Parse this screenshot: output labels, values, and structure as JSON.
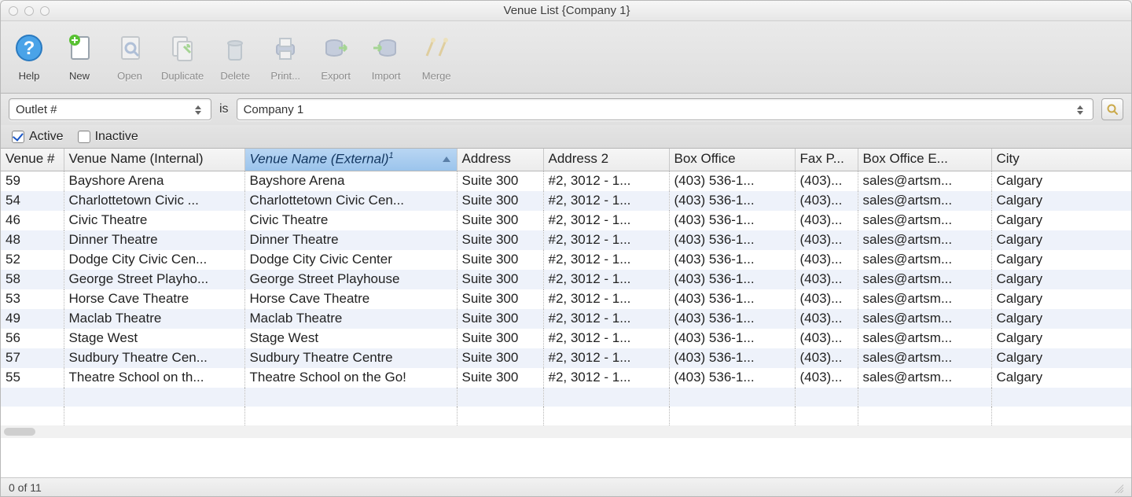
{
  "window": {
    "title": "Venue List {Company 1}"
  },
  "toolbar": [
    {
      "id": "help",
      "label": "Help",
      "enabled": true,
      "icon": "help-icon"
    },
    {
      "id": "new",
      "label": "New",
      "enabled": true,
      "icon": "new-icon"
    },
    {
      "id": "open",
      "label": "Open",
      "enabled": false,
      "icon": "open-icon"
    },
    {
      "id": "duplicate",
      "label": "Duplicate",
      "enabled": false,
      "icon": "duplicate-icon"
    },
    {
      "id": "delete",
      "label": "Delete",
      "enabled": false,
      "icon": "delete-icon"
    },
    {
      "id": "print",
      "label": "Print...",
      "enabled": false,
      "icon": "print-icon"
    },
    {
      "id": "export",
      "label": "Export",
      "enabled": false,
      "icon": "export-icon"
    },
    {
      "id": "import",
      "label": "Import",
      "enabled": false,
      "icon": "import-icon"
    },
    {
      "id": "merge",
      "label": "Merge",
      "enabled": false,
      "icon": "merge-icon"
    }
  ],
  "filter": {
    "field_select": "Outlet #",
    "operator": "is",
    "value_select": "Company 1",
    "active": {
      "label": "Active",
      "checked": true
    },
    "inactive": {
      "label": "Inactive",
      "checked": false
    }
  },
  "table": {
    "columns": [
      {
        "key": "venue_no",
        "label": "Venue #"
      },
      {
        "key": "name_int",
        "label": "Venue Name (Internal)"
      },
      {
        "key": "name_ext",
        "label": "Venue Name (External)",
        "sorted": true,
        "sort_index": "1"
      },
      {
        "key": "addr",
        "label": "Address"
      },
      {
        "key": "addr2",
        "label": "Address 2"
      },
      {
        "key": "box",
        "label": "Box Office"
      },
      {
        "key": "fax",
        "label": "Fax P..."
      },
      {
        "key": "email",
        "label": "Box Office E..."
      },
      {
        "key": "city",
        "label": "City"
      }
    ],
    "rows": [
      {
        "venue_no": "59",
        "name_int": "Bayshore Arena",
        "name_ext": "Bayshore Arena",
        "addr": "Suite 300",
        "addr2": "#2, 3012 - 1...",
        "box": "(403) 536-1...",
        "fax": "(403)...",
        "email": "sales@artsm...",
        "city": "Calgary"
      },
      {
        "venue_no": "54",
        "name_int": "Charlottetown Civic ...",
        "name_ext": "Charlottetown Civic Cen...",
        "addr": "Suite 300",
        "addr2": "#2, 3012 - 1...",
        "box": "(403) 536-1...",
        "fax": "(403)...",
        "email": "sales@artsm...",
        "city": "Calgary"
      },
      {
        "venue_no": "46",
        "name_int": "Civic Theatre",
        "name_ext": "Civic Theatre",
        "addr": "Suite 300",
        "addr2": "#2, 3012 - 1...",
        "box": "(403) 536-1...",
        "fax": "(403)...",
        "email": "sales@artsm...",
        "city": "Calgary"
      },
      {
        "venue_no": "48",
        "name_int": "Dinner Theatre",
        "name_ext": "Dinner Theatre",
        "addr": "Suite 300",
        "addr2": "#2, 3012 - 1...",
        "box": "(403) 536-1...",
        "fax": "(403)...",
        "email": "sales@artsm...",
        "city": "Calgary"
      },
      {
        "venue_no": "52",
        "name_int": "Dodge City Civic Cen...",
        "name_ext": "Dodge City Civic Center",
        "addr": "Suite 300",
        "addr2": "#2, 3012 - 1...",
        "box": "(403) 536-1...",
        "fax": "(403)...",
        "email": "sales@artsm...",
        "city": "Calgary"
      },
      {
        "venue_no": "58",
        "name_int": "George Street Playho...",
        "name_ext": "George Street Playhouse",
        "addr": "Suite 300",
        "addr2": "#2, 3012 - 1...",
        "box": "(403) 536-1...",
        "fax": "(403)...",
        "email": "sales@artsm...",
        "city": "Calgary"
      },
      {
        "venue_no": "53",
        "name_int": "Horse Cave Theatre",
        "name_ext": "Horse Cave Theatre",
        "addr": "Suite 300",
        "addr2": "#2, 3012 - 1...",
        "box": "(403) 536-1...",
        "fax": "(403)...",
        "email": "sales@artsm...",
        "city": "Calgary"
      },
      {
        "venue_no": "49",
        "name_int": "Maclab Theatre",
        "name_ext": "Maclab Theatre",
        "addr": "Suite 300",
        "addr2": "#2, 3012 - 1...",
        "box": "(403) 536-1...",
        "fax": "(403)...",
        "email": "sales@artsm...",
        "city": "Calgary"
      },
      {
        "venue_no": "56",
        "name_int": "Stage West",
        "name_ext": "Stage West",
        "addr": "Suite 300",
        "addr2": "#2, 3012 - 1...",
        "box": "(403) 536-1...",
        "fax": "(403)...",
        "email": "sales@artsm...",
        "city": "Calgary"
      },
      {
        "venue_no": "57",
        "name_int": "Sudbury Theatre Cen...",
        "name_ext": "Sudbury Theatre Centre",
        "addr": "Suite 300",
        "addr2": "#2, 3012 - 1...",
        "box": "(403) 536-1...",
        "fax": "(403)...",
        "email": "sales@artsm...",
        "city": "Calgary"
      },
      {
        "venue_no": "55",
        "name_int": "Theatre School on th...",
        "name_ext": "Theatre School on the Go!",
        "addr": "Suite 300",
        "addr2": "#2, 3012 - 1...",
        "box": "(403) 536-1...",
        "fax": "(403)...",
        "email": "sales@artsm...",
        "city": "Calgary"
      }
    ]
  },
  "status": {
    "text": "0 of 11"
  }
}
